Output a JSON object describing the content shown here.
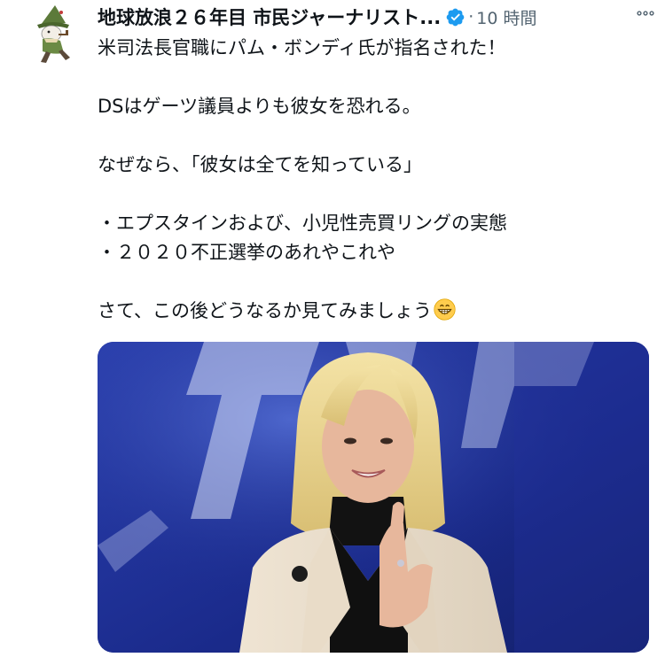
{
  "post": {
    "author": {
      "display_name": "地球放浪２６年目 市民ジャーナリスト...",
      "avatar_icon": "snufkin-character-avatar",
      "verified_icon": "verified-badge-icon"
    },
    "separator": "·",
    "timestamp": "10 時間",
    "more_icon": "more-options-icon",
    "lines": [
      "米司法長官職にパム・ボンディ氏が指名された！",
      "",
      "DSはゲーツ議員よりも彼女を恐れる。",
      "",
      "なぜなら、「彼女は全てを知っている」",
      "",
      "・エプスタインおよび、小児性売買リングの実態",
      "・２０２０不正選挙のあれやこれや",
      "",
      "さて、この後どうなるか見てみましょう"
    ],
    "last_line_emoji": "grinning-face-emoji",
    "media": {
      "description_icon": "photo-woman-speaking-at-conference",
      "accent_color": "#1e2f8a"
    }
  },
  "colors": {
    "text": "#0f1419",
    "muted": "#536471",
    "verified": "#1d9bf0"
  }
}
